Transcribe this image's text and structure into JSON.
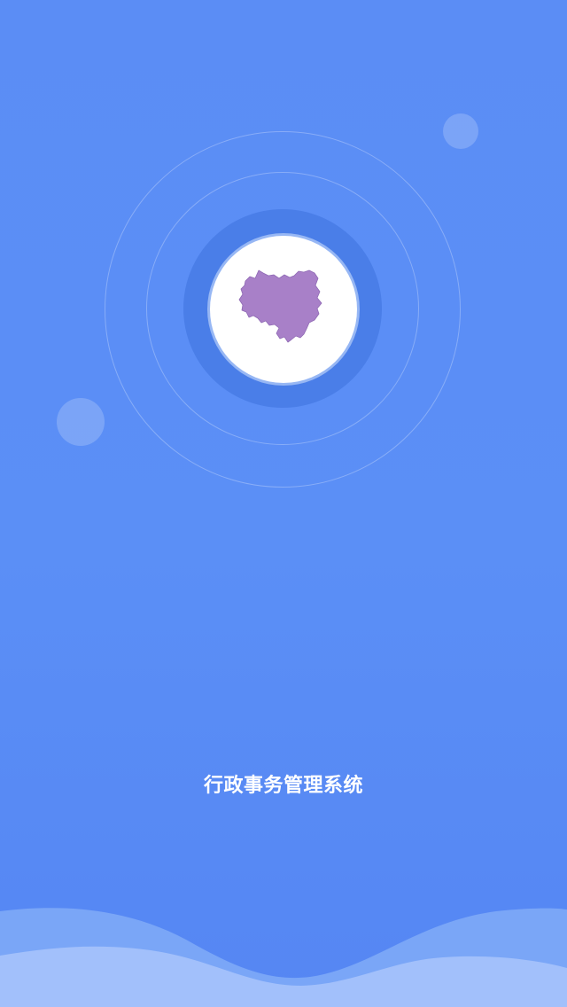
{
  "splash": {
    "app_title": "行政事务管理系统"
  },
  "colors": {
    "background": "#5b8df5",
    "halo": "#4a7ee8",
    "logo_fill": "#a880c8",
    "wave_back": "#7aa6f7",
    "wave_front": "#a2c0fb"
  },
  "icons": {
    "logo": "region-map-icon"
  }
}
